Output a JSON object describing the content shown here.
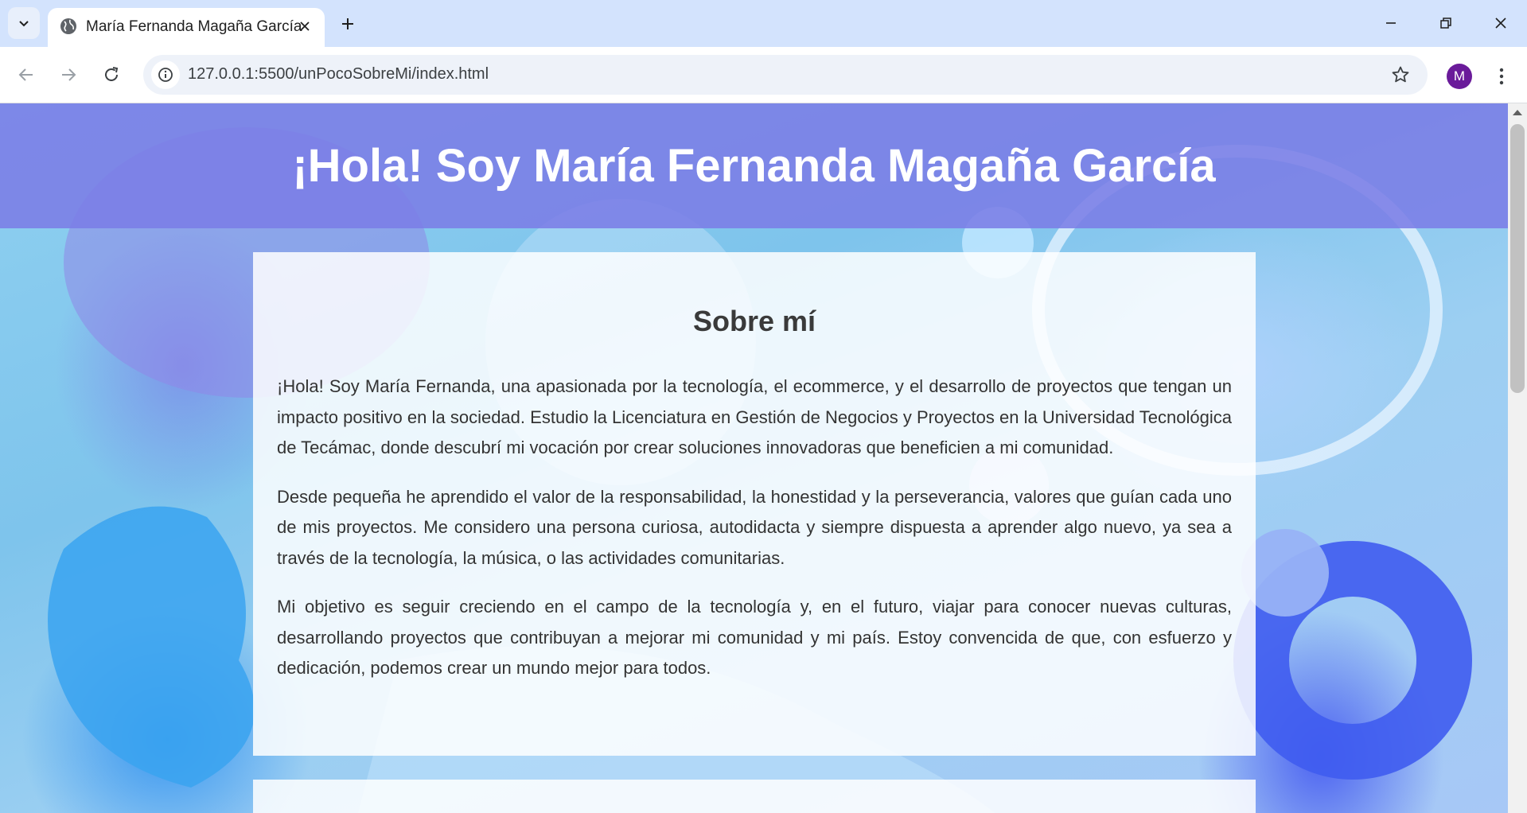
{
  "browser": {
    "tab": {
      "title": "María Fernanda Magaña García"
    },
    "address_bar": {
      "url": "127.0.0.1:5500/unPocoSobreMi/index.html"
    },
    "profile_initial": "M",
    "icons": {
      "tab_search": "chevron-down-icon",
      "favicon": "globe-icon",
      "tab_close": "close-icon",
      "new_tab": "plus-icon",
      "minimize": "minimize-icon",
      "restore": "restore-icon",
      "close_window": "close-icon",
      "back": "arrow-left-icon",
      "forward": "arrow-right-icon",
      "reload": "reload-icon",
      "site_info": "info-icon",
      "bookmark": "star-icon",
      "menu": "kebab-menu-icon"
    }
  },
  "page": {
    "header_title": "¡Hola! Soy María Fernanda Magaña García",
    "section": {
      "title": "Sobre mí",
      "paragraphs": [
        "¡Hola! Soy María Fernanda, una apasionada por la tecnología, el ecommerce, y el desarrollo de proyectos que tengan un impacto positivo en la sociedad. Estudio la Licenciatura en Gestión de Negocios y Proyectos en la Universidad Tecnológica de Tecámac, donde descubrí mi vocación por crear soluciones innovadoras que beneficien a mi comunidad.",
        "Desde pequeña he aprendido el valor de la responsabilidad, la honestidad y la perseverancia, valores que guían cada uno de mis proyectos. Me considero una persona curiosa, autodidacta y siempre dispuesta a aprender algo nuevo, ya sea a través de la tecnología, la música, o las actividades comunitarias.",
        "Mi objetivo es seguir creciendo en el campo de la tecnología y, en el futuro, viajar para conocer nuevas culturas, desarrollando proyectos que contribuyan a mejorar mi comunidad y mi país. Estoy convencida de que, con esfuerzo y dedicación, podemos crear un mundo mejor para todos."
      ]
    }
  },
  "colors": {
    "tabstrip": "#d3e3fd",
    "header_band": "#7b7de6",
    "avatar": "#6a1b9a",
    "card": "#ffffff"
  }
}
